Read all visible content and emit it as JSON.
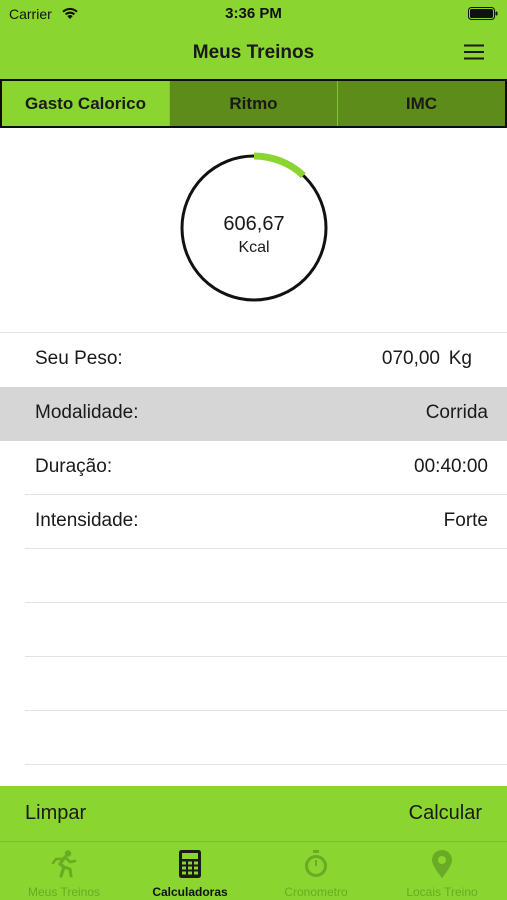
{
  "status": {
    "carrier": "Carrier",
    "time": "3:36 PM"
  },
  "nav": {
    "title": "Meus Treinos",
    "menu_icon": "hamburger-menu-icon"
  },
  "tabs": [
    {
      "label": "Gasto Calorico",
      "active": true
    },
    {
      "label": "Ritmo",
      "active": false
    },
    {
      "label": "IMC",
      "active": false
    }
  ],
  "gauge": {
    "value": "606,67",
    "unit": "Kcal",
    "progress": 0.12
  },
  "form": {
    "weight": {
      "label": "Seu Peso:",
      "value": "070,00",
      "unit": "Kg"
    },
    "mode": {
      "label": "Modalidade:",
      "value": "Corrida"
    },
    "duration": {
      "label": "Duração:",
      "value": "00:40:00"
    },
    "intensity": {
      "label": "Intensidade:",
      "value": "Forte"
    }
  },
  "actions": {
    "clear": "Limpar",
    "calculate": "Calcular"
  },
  "tabbar": [
    {
      "label": "Meus Treinos",
      "icon": "runner-icon",
      "active": false
    },
    {
      "label": "Calculadoras",
      "icon": "calculator-icon",
      "active": true
    },
    {
      "label": "Cronometro",
      "icon": "stopwatch-icon",
      "active": false
    },
    {
      "label": "Locais Treino",
      "icon": "location-pin-icon",
      "active": false
    }
  ],
  "colors": {
    "accent": "#8ad52f",
    "tab_dark": "#5d8c1a",
    "selected_row": "#d6d6d6"
  }
}
